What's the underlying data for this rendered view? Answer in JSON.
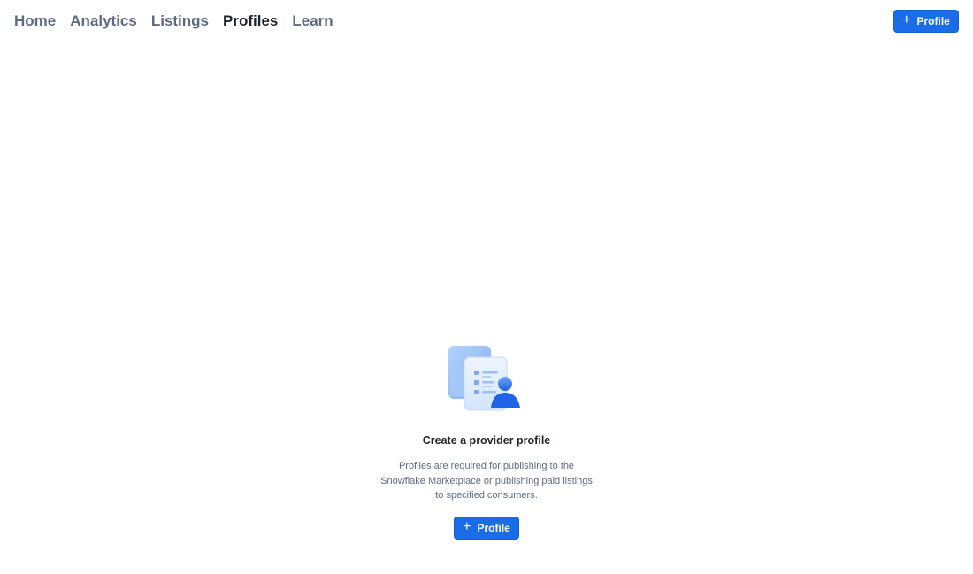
{
  "nav": {
    "items": [
      {
        "label": "Home"
      },
      {
        "label": "Analytics"
      },
      {
        "label": "Listings"
      },
      {
        "label": "Profiles",
        "active": true
      },
      {
        "label": "Learn"
      }
    ]
  },
  "header": {
    "add_profile_label": "Profile"
  },
  "empty_state": {
    "illustration_icon": "provider-profile-illustration",
    "title": "Create a provider profile",
    "description": "Profiles are required for publishing to the Snowflake Marketplace or publishing paid listings to specified consumers.",
    "button_label": "Profile"
  },
  "colors": {
    "primary": "#1a6ce7",
    "nav_inactive": "#5d6a85",
    "nav_active": "#1e252f"
  }
}
